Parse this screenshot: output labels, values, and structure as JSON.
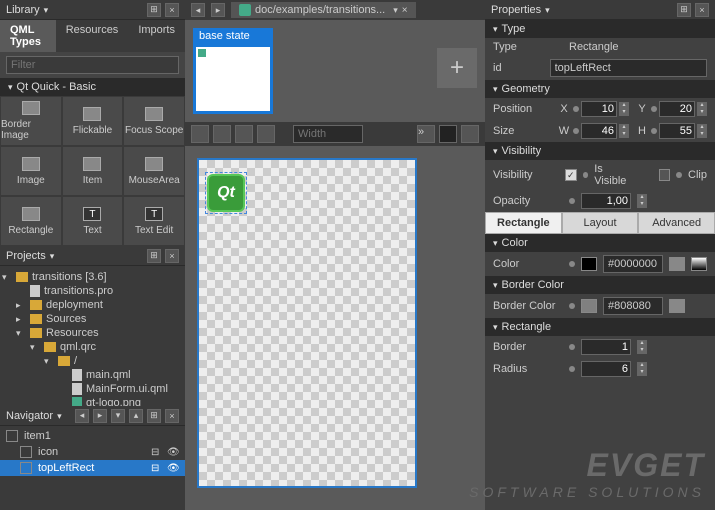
{
  "library": {
    "title": "Library",
    "tabs": [
      "QML Types",
      "Resources",
      "Imports"
    ],
    "active_tab": 0,
    "filter_placeholder": "Filter",
    "section": "Qt Quick - Basic",
    "components": [
      "Border Image",
      "Flickable",
      "Focus Scope",
      "Image",
      "Item",
      "MouseArea",
      "Rectangle",
      "Text",
      "Text Edit"
    ]
  },
  "projects": {
    "title": "Projects",
    "root": "transitions [3.6]",
    "items": [
      {
        "name": "transitions.pro",
        "indent": 1,
        "type": "file"
      },
      {
        "name": "deployment",
        "indent": 1,
        "type": "folder"
      },
      {
        "name": "Sources",
        "indent": 1,
        "type": "folder"
      },
      {
        "name": "Resources",
        "indent": 1,
        "type": "folder",
        "open": true
      },
      {
        "name": "qml.qrc",
        "indent": 2,
        "type": "folder",
        "open": true
      },
      {
        "name": "/",
        "indent": 3,
        "type": "folder",
        "open": true
      },
      {
        "name": "main.qml",
        "indent": 4,
        "type": "file"
      },
      {
        "name": "MainForm.ui.qml",
        "indent": 4,
        "type": "file"
      },
      {
        "name": "qt-logo.png",
        "indent": 4,
        "type": "file"
      }
    ]
  },
  "navigator": {
    "title": "Navigator",
    "items": [
      {
        "name": "item1",
        "selected": false,
        "indent": 0
      },
      {
        "name": "icon",
        "selected": false,
        "indent": 1
      },
      {
        "name": "topLeftRect",
        "selected": true,
        "indent": 1
      }
    ]
  },
  "editor": {
    "file_tab": "doc/examples/transitions...",
    "state_label": "base state",
    "width_placeholder": "Width",
    "add_state": "+",
    "qt_text": "Qt"
  },
  "properties": {
    "title": "Properties",
    "type_section": "Type",
    "type_label": "Type",
    "type_value": "Rectangle",
    "id_label": "id",
    "id_value": "topLeftRect",
    "geometry_section": "Geometry",
    "position_label": "Position",
    "pos_x": "10",
    "pos_y": "20",
    "size_label": "Size",
    "size_w": "46",
    "size_h": "55",
    "visibility_section": "Visibility",
    "visibility_label": "Visibility",
    "is_visible_label": "Is Visible",
    "clip_label": "Clip",
    "opacity_label": "Opacity",
    "opacity_value": "1,00",
    "tabs": [
      "Rectangle",
      "Layout",
      "Advanced"
    ],
    "active_tab": 0,
    "color_section": "Color",
    "color_label": "Color",
    "color_value": "#0000000",
    "border_color_section": "Border Color",
    "border_color_label": "Border Color",
    "border_color_value": "#808080",
    "rectangle_section": "Rectangle",
    "border_label": "Border",
    "border_value": "1",
    "radius_label": "Radius",
    "radius_value": "6",
    "axis_x": "X",
    "axis_y": "Y",
    "axis_w": "W",
    "axis_h": "H"
  },
  "watermark": {
    "line1": "EVGET",
    "line2": "SOFTWARE SOLUTIONS"
  }
}
